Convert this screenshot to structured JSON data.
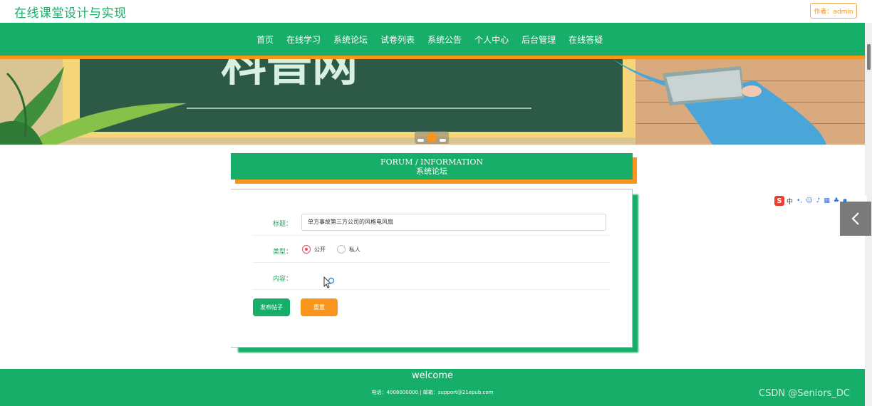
{
  "header": {
    "site_title": "在线课堂设计与实现",
    "author_badge": "作者：admin"
  },
  "nav": {
    "items": [
      {
        "label": "首页"
      },
      {
        "label": "在线学习"
      },
      {
        "label": "系统论坛"
      },
      {
        "label": "试卷列表"
      },
      {
        "label": "系统公告"
      },
      {
        "label": "个人中心"
      },
      {
        "label": "后台管理"
      },
      {
        "label": "在线答疑"
      }
    ]
  },
  "banner": {
    "board_text": "科普网"
  },
  "section": {
    "title_en": "FORUM / INFORMATION",
    "title_cn": "系统论坛"
  },
  "form": {
    "title_label": "标题：",
    "title_value": "单方事故第三方公司的风格电风扇",
    "type_label": "类型：",
    "type_options": [
      {
        "label": "公开",
        "checked": true
      },
      {
        "label": "私人",
        "checked": false
      }
    ],
    "content_label": "内容：",
    "publish_button": "发布帖子",
    "reset_button": "重置"
  },
  "ime": {
    "logo": "S",
    "mode": "中"
  },
  "footer": {
    "welcome": "welcome",
    "contact": "电话：4008000000 | 邮箱：support@21epub.com"
  },
  "watermark": "CSDN @Seniors_DC",
  "colors": {
    "primary_green": "#16ae68",
    "accent_orange": "#f7951d"
  }
}
